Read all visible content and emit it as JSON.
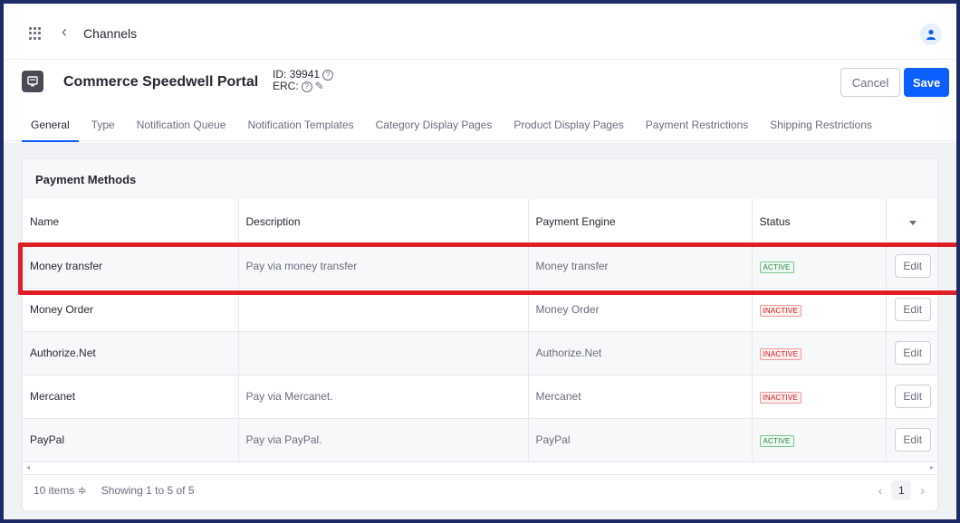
{
  "topbar": {
    "breadcrumb": "Channels",
    "apps_icon": "grid-icon",
    "back_icon": "chevron-left-icon",
    "user_icon": "user-icon"
  },
  "header": {
    "title": "Commerce Speedwell Portal",
    "id_label": "ID: 39941",
    "erc_label": "ERC:",
    "cancel_label": "Cancel",
    "save_label": "Save"
  },
  "tabs": [
    "General",
    "Type",
    "Notification Queue",
    "Notification Templates",
    "Category Display Pages",
    "Product Display Pages",
    "Payment Restrictions",
    "Shipping Restrictions"
  ],
  "card": {
    "title": "Payment Methods",
    "columns": [
      "Name",
      "Description",
      "Payment Engine",
      "Status"
    ],
    "rows": [
      {
        "name": "Money transfer",
        "description": "Pay via money transfer",
        "engine": "Money transfer",
        "status": "ACTIVE",
        "edit": "Edit"
      },
      {
        "name": "Money Order",
        "description": "",
        "engine": "Money Order",
        "status": "INACTIVE",
        "edit": "Edit"
      },
      {
        "name": "Authorize.Net",
        "description": "",
        "engine": "Authorize.Net",
        "status": "INACTIVE",
        "edit": "Edit"
      },
      {
        "name": "Mercanet",
        "description": "Pay via Mercanet.",
        "engine": "Mercanet",
        "status": "INACTIVE",
        "edit": "Edit"
      },
      {
        "name": "PayPal",
        "description": "Pay via PayPal.",
        "engine": "PayPal",
        "status": "ACTIVE",
        "edit": "Edit"
      }
    ]
  },
  "footer": {
    "items_per_page": "10 items ≑",
    "showing": "Showing 1 to 5 of 5",
    "page": "1"
  },
  "colors": {
    "accent": "#0b5fff",
    "highlight": "#e01e26",
    "active": "#287d3c",
    "inactive": "#da1414"
  }
}
